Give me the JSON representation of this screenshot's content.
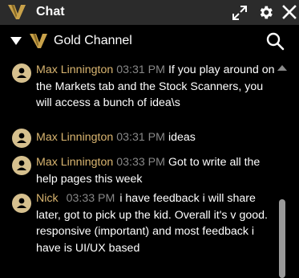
{
  "window": {
    "title": "Chat"
  },
  "channel": {
    "name": "Gold Channel"
  },
  "messages": [
    {
      "author": "Max Linnington",
      "time": "03:31 PM",
      "text": "If you play around on the Markets tab and the Stock Scanners, you will access a bunch of idea\\s"
    },
    {
      "author": "Max Linnington",
      "time": "03:31 PM",
      "text": "ideas"
    },
    {
      "author": "Max Linnington",
      "time": "03:33 PM",
      "text": "Got to write all the help pages this week"
    },
    {
      "author": "Nick",
      "time": "03:33 PM",
      "text": "i have feedback i will share later, got to pick up the kid. Overall it's v good. responsive (important) and most feedback i have is UI/UX based"
    }
  ],
  "colors": {
    "titlebar_bg": "#2b2b2b",
    "author": "#d9b570",
    "timestamp": "#888888",
    "avatar": "#d6c08e",
    "logo_gold": "#c9a24a"
  },
  "icons": {
    "window_logo": "v-logo-icon",
    "expand": "expand-icon",
    "settings": "gear-icon",
    "close": "close-icon",
    "channel_toggle": "caret-down-icon",
    "search": "search-icon",
    "avatar": "user-icon"
  }
}
